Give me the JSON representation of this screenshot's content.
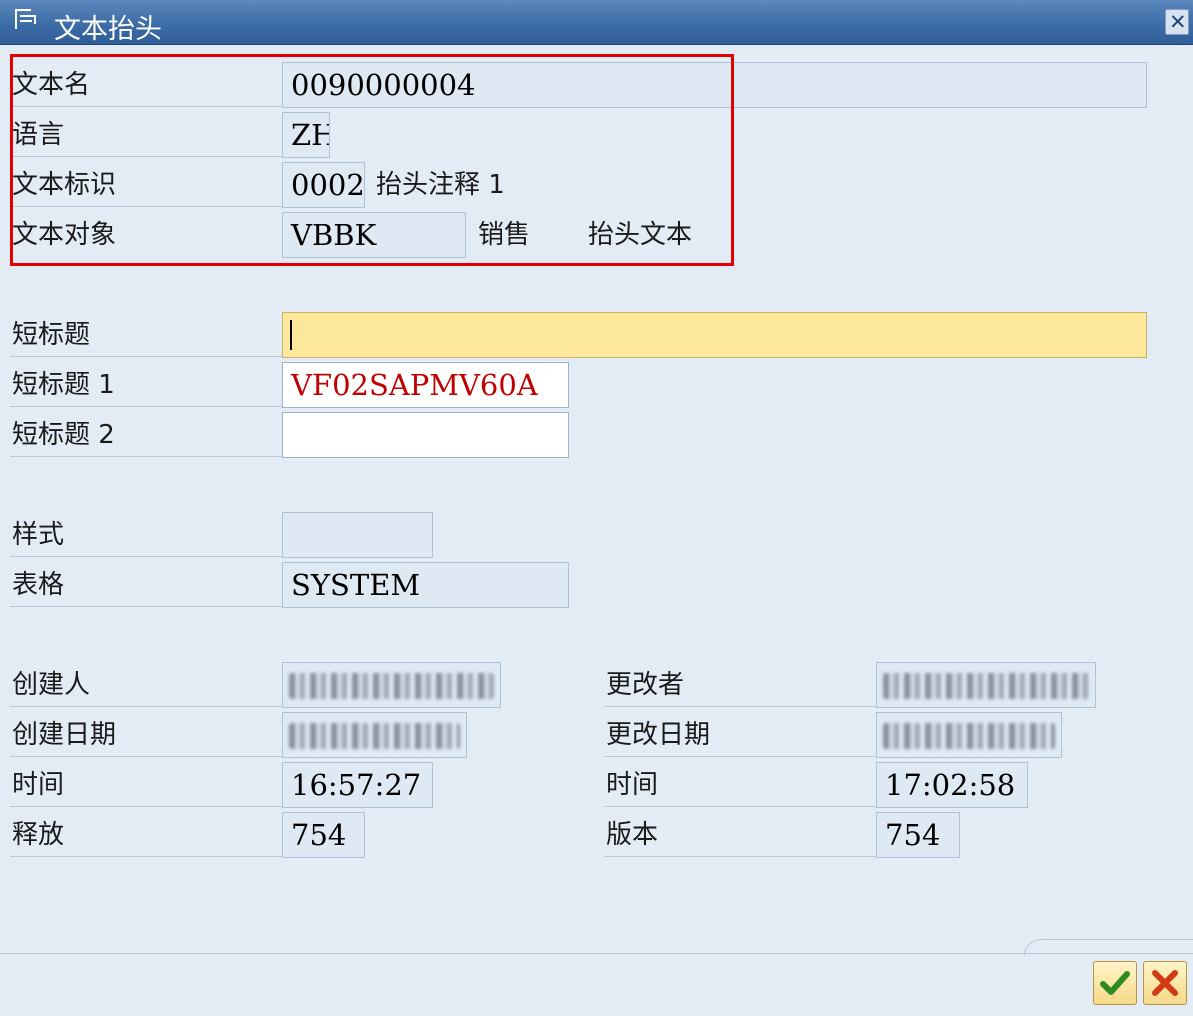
{
  "window": {
    "title": "文本抬头",
    "close_symbol": "✕"
  },
  "header_section": {
    "text_name": {
      "label": "文本名",
      "value": "0090000004"
    },
    "language": {
      "label": "语言",
      "value": "ZH"
    },
    "text_id": {
      "label": "文本标识",
      "value": "0002",
      "description": "抬头注释 1"
    },
    "text_object": {
      "label": "文本对象",
      "value": "VBBK",
      "description_1": "销售",
      "description_2": "抬头文本"
    }
  },
  "titles": {
    "short_title": {
      "label": "短标题",
      "value": ""
    },
    "short_title_1": {
      "label": "短标题 1",
      "value": "VF02SAPMV60A"
    },
    "short_title_2": {
      "label": "短标题 2",
      "value": ""
    }
  },
  "layout_section": {
    "style": {
      "label": "样式",
      "value": ""
    },
    "form": {
      "label": "表格",
      "value": "SYSTEM"
    }
  },
  "admin": {
    "created_by": {
      "label": "创建人",
      "value": ""
    },
    "created_date": {
      "label": "创建日期",
      "value": ""
    },
    "created_time": {
      "label": "时间",
      "value": "16:57:27"
    },
    "release": {
      "label": "释放",
      "value": "754"
    },
    "changed_by": {
      "label": "更改者",
      "value": ""
    },
    "changed_date": {
      "label": "更改日期",
      "value": ""
    },
    "changed_time": {
      "label": "时间",
      "value": "17:02:58"
    },
    "version": {
      "label": "版本",
      "value": "754"
    }
  },
  "buttons": {
    "confirm_icon": "checkmark-icon",
    "cancel_icon": "cancel-icon"
  },
  "colors": {
    "title_bar": "#3b6aa5",
    "background": "#e3ecf5",
    "highlight_box": "#e00000",
    "required_field": "#fde79a",
    "red_value": "#c00000"
  }
}
